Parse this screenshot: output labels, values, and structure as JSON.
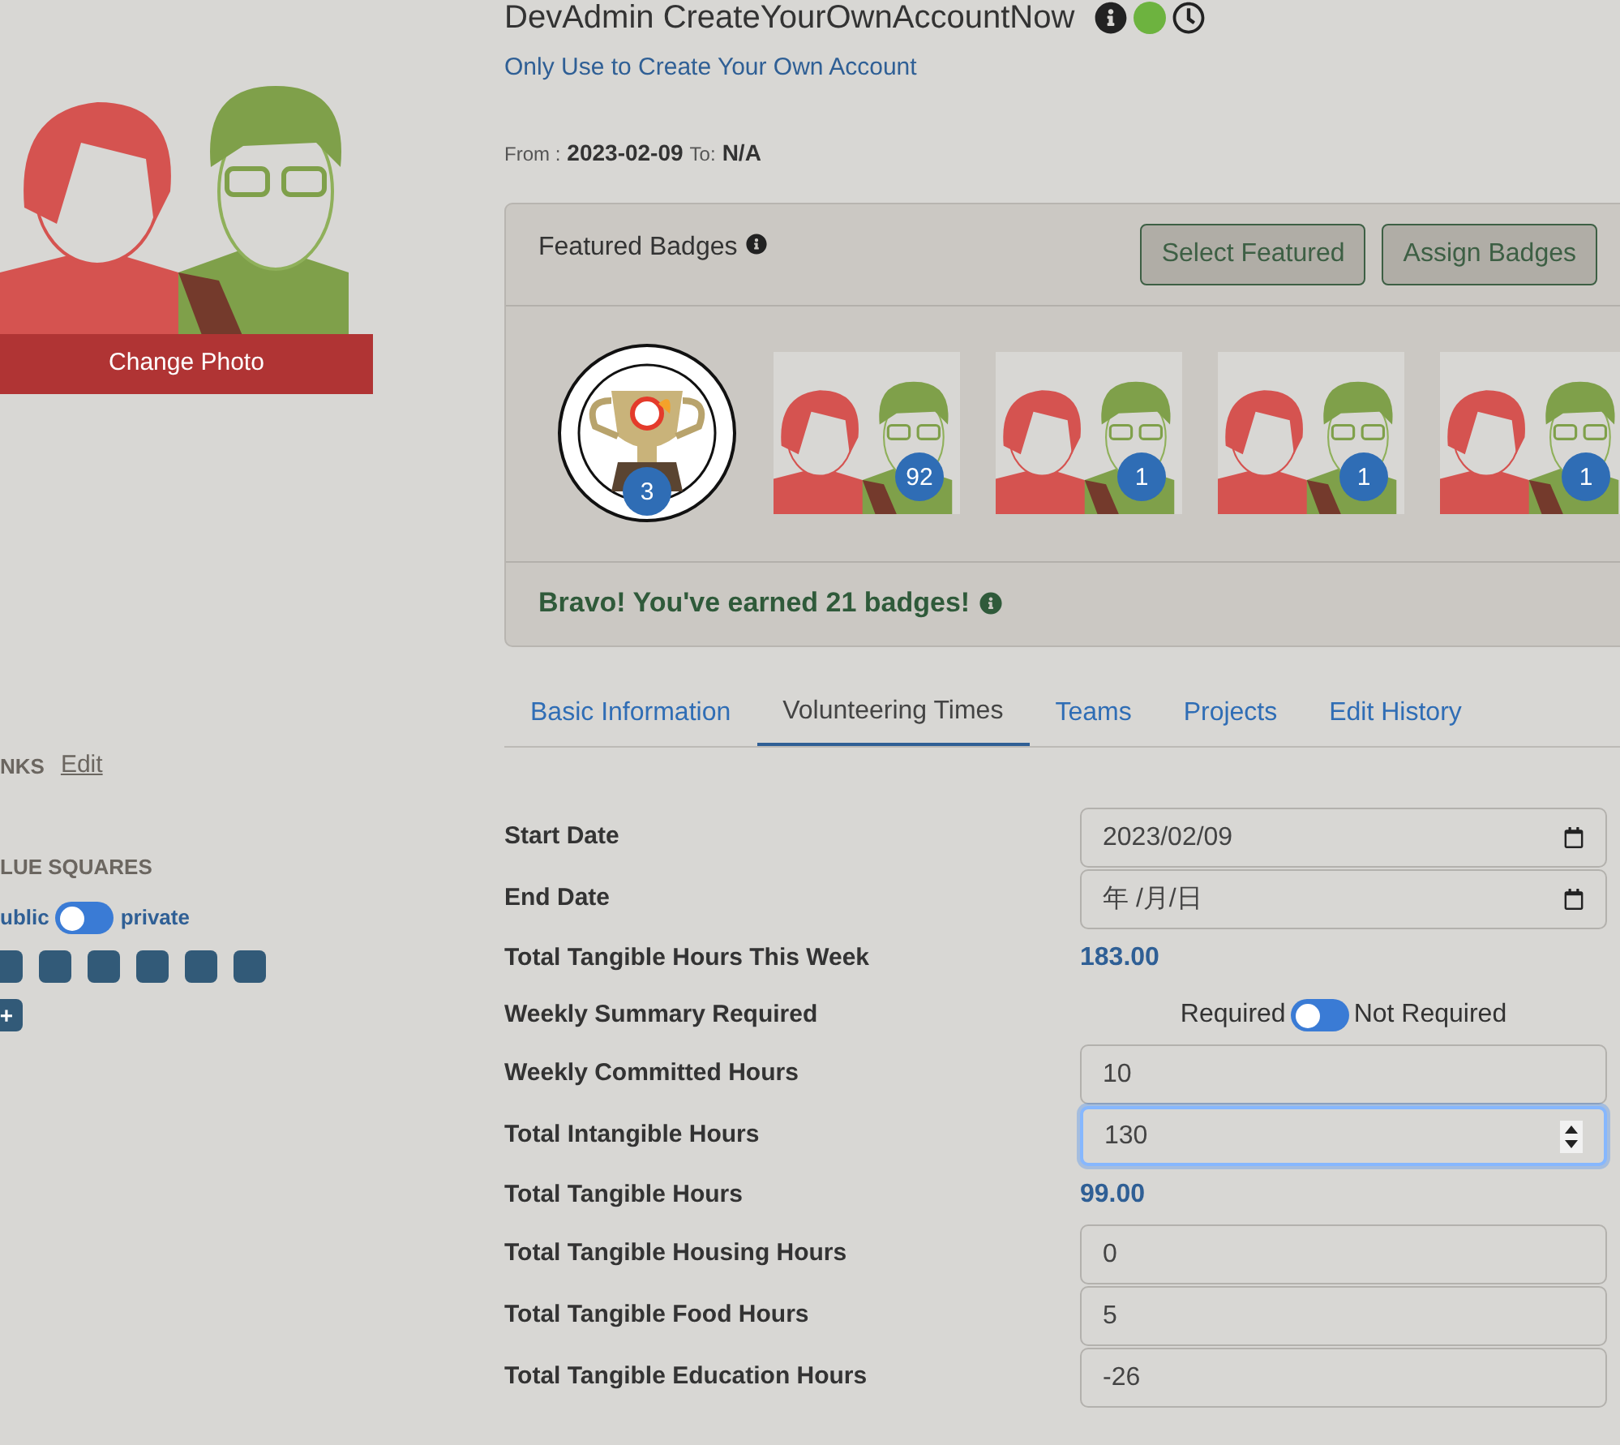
{
  "sidebar": {
    "change_photo": "Change Photo",
    "links_label": "NKS",
    "links_edit": "Edit",
    "blue_squares_label": "LUE SQUARES",
    "privacy": {
      "left": "ublic",
      "right": "private",
      "on": false
    },
    "squares": [
      {
        "kind": "square"
      },
      {
        "kind": "square"
      },
      {
        "kind": "square"
      },
      {
        "kind": "square"
      },
      {
        "kind": "square"
      },
      {
        "kind": "square"
      },
      {
        "kind": "add",
        "label": "+"
      }
    ]
  },
  "header": {
    "name": "DevAdmin CreateYourOwnAccountNow",
    "status_icons": [
      {
        "kind": "info"
      },
      {
        "kind": "dot"
      },
      {
        "kind": "clock"
      }
    ],
    "subtitle": "Only Use to Create Your Own Account",
    "from_label": "From :",
    "from_date": "2023-02-09",
    "to_label": "To:",
    "to_value": "N/A"
  },
  "badges": {
    "title": "Featured Badges",
    "buttons": [
      "Select Featured",
      "Assign Badges"
    ],
    "items": [
      {
        "kind": "trophy",
        "count": "3"
      },
      {
        "kind": "profile",
        "count": "92"
      },
      {
        "kind": "profile",
        "count": "1"
      },
      {
        "kind": "profile",
        "count": "1"
      },
      {
        "kind": "profile",
        "count": "1"
      }
    ],
    "footer": "Bravo! You've earned 21 badges!"
  },
  "tabs": [
    {
      "label": "Basic Information",
      "selected": false
    },
    {
      "label": "Volunteering Times",
      "selected": true
    },
    {
      "label": "Teams",
      "selected": false
    },
    {
      "label": "Projects",
      "selected": false
    },
    {
      "label": "Edit History",
      "selected": false
    }
  ],
  "fields": [
    {
      "kind": "date",
      "label": "Start Date",
      "value": "2023/02/09"
    },
    {
      "kind": "date",
      "label": "End Date",
      "value": "年 /月/日"
    },
    {
      "kind": "value",
      "label": "Total Tangible Hours This Week",
      "value": "183.00"
    },
    {
      "kind": "toggle",
      "label": "Weekly Summary Required",
      "left": "Required",
      "right": "Not Required",
      "on": false
    },
    {
      "kind": "input",
      "label": "Weekly Committed Hours",
      "value": "10"
    },
    {
      "kind": "number",
      "label": "Total Intangible Hours",
      "value": "130",
      "focused": true
    },
    {
      "kind": "value",
      "label": "Total Tangible Hours",
      "value": "99.00"
    },
    {
      "kind": "input",
      "label": "Total Tangible Housing Hours",
      "value": "0"
    },
    {
      "kind": "input",
      "label": "Total Tangible Food Hours",
      "value": "5"
    },
    {
      "kind": "input",
      "label": "Total Tangible Education Hours",
      "value": "-26"
    }
  ]
}
